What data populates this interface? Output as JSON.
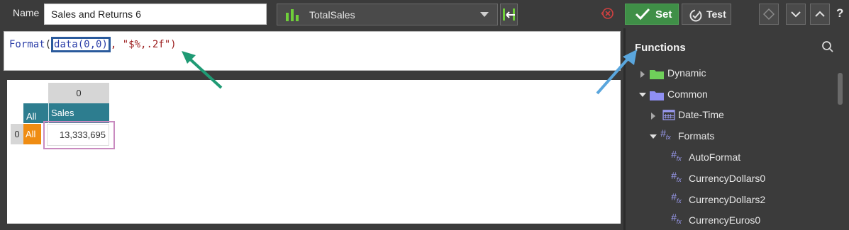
{
  "toolbar": {
    "name_label": "Name",
    "name_value": "Sales and Returns 6",
    "measure_label": "TotalSales",
    "set_label": "Set",
    "test_label": "Test",
    "help_label": "?"
  },
  "editor": {
    "fn_name": "Format",
    "open_paren": "(",
    "data_call": "data(0,0)",
    "rest": ", \"$%,.2f\")"
  },
  "grid": {
    "column_index": "0",
    "all_column": "All",
    "measure_header": "Sales",
    "row_index": "0",
    "all_row": "All",
    "value": "13,333,695"
  },
  "functions": {
    "title": "Functions",
    "tree": [
      {
        "label": "Dynamic",
        "type": "folder",
        "color": "#6fcf5a",
        "expanded": false
      },
      {
        "label": "Common",
        "type": "folder",
        "color": "#8f8ff2",
        "expanded": true
      },
      {
        "label": "Date-Time",
        "type": "calendar",
        "expanded": false
      },
      {
        "label": "Formats",
        "type": "fx",
        "expanded": true
      },
      {
        "label": "AutoFormat",
        "type": "fx"
      },
      {
        "label": "CurrencyDollars0",
        "type": "fx"
      },
      {
        "label": "CurrencyDollars2",
        "type": "fx"
      },
      {
        "label": "CurrencyEuros0",
        "type": "fx"
      }
    ]
  },
  "colors": {
    "set_button": "#3f8f47",
    "grid_header": "#2d7d8f",
    "all_row": "#ef8c12",
    "data_highlight": "#2a5a9c",
    "value_highlight": "#c98bc0",
    "arrow_green": "#1f9a74",
    "arrow_blue": "#5aa6dd"
  }
}
